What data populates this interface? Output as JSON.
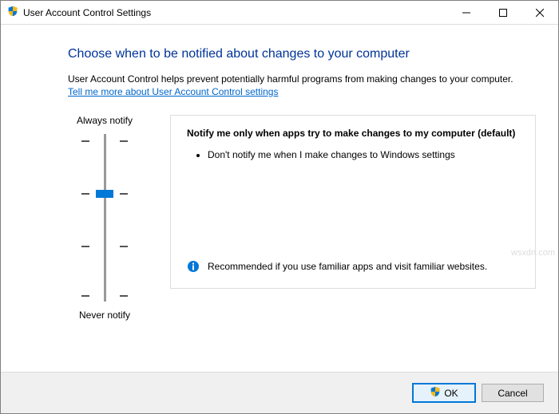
{
  "window": {
    "title": "User Account Control Settings"
  },
  "page": {
    "heading": "Choose when to be notified about changes to your computer",
    "description": "User Account Control helps prevent potentially harmful programs from making changes to your computer.",
    "link_text": "Tell me more about User Account Control settings"
  },
  "slider": {
    "top_label": "Always notify",
    "bottom_label": "Never notify"
  },
  "info": {
    "title": "Notify me only when apps try to make changes to my computer (default)",
    "bullet1": "Don't notify me when I make changes to Windows settings",
    "recommendation": "Recommended if you use familiar apps and visit familiar websites."
  },
  "buttons": {
    "ok": "OK",
    "cancel": "Cancel"
  },
  "watermark": "wsxdn.com"
}
